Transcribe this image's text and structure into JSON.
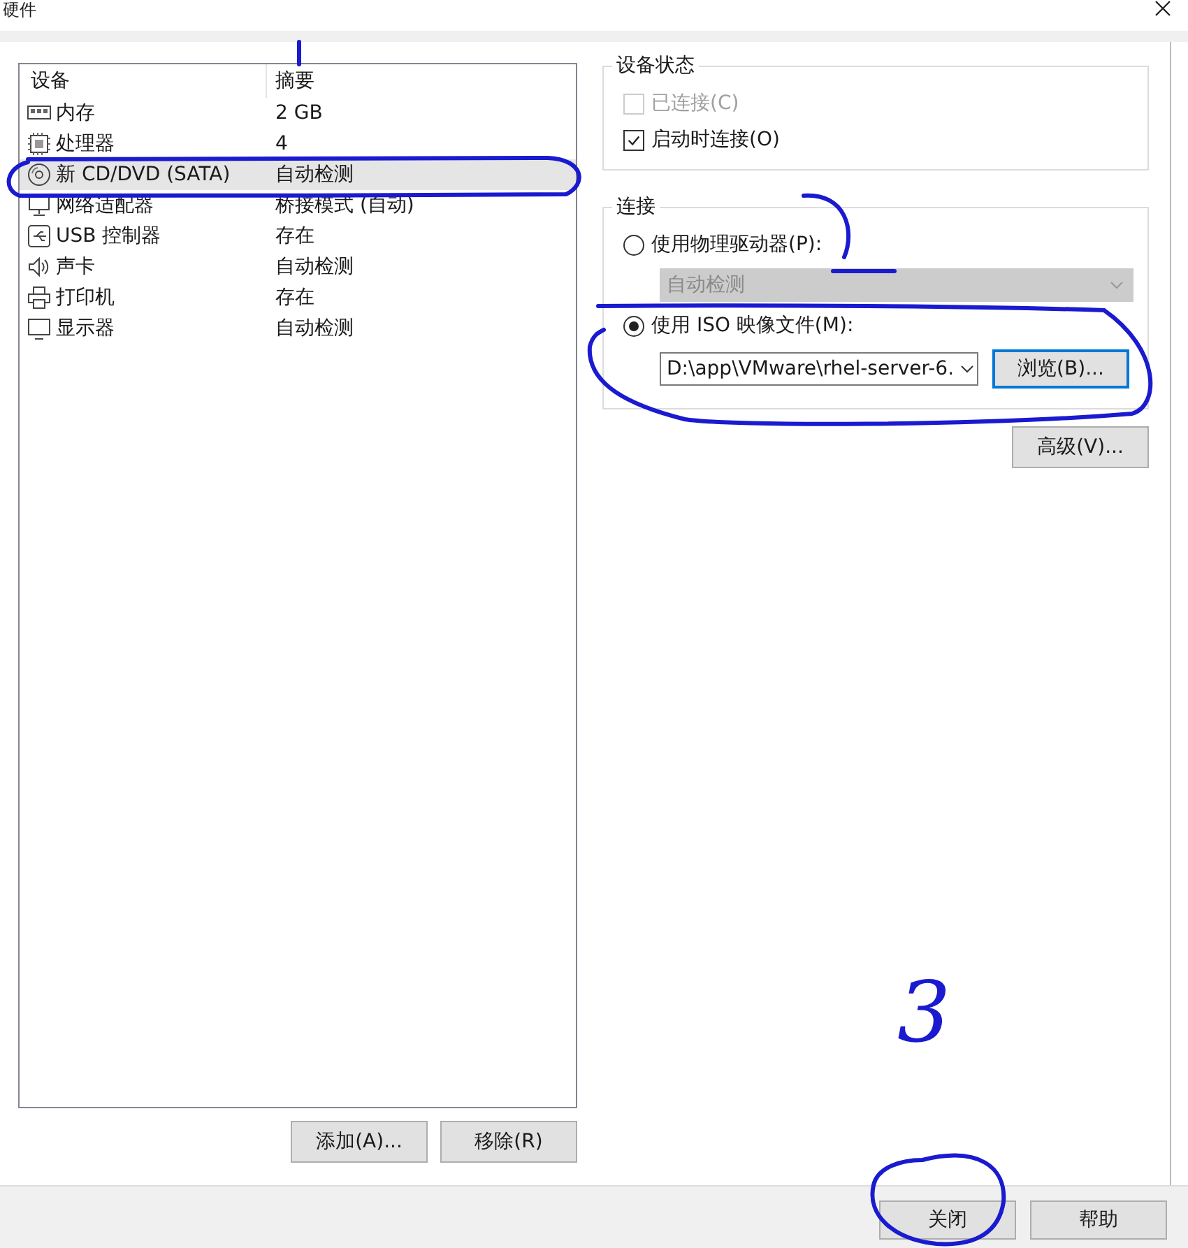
{
  "window": {
    "title": "硬件"
  },
  "device_list": {
    "columns": [
      "设备",
      "摘要"
    ],
    "rows": [
      {
        "kind": "memory",
        "device": "内存",
        "summary": "2 GB",
        "selected": false
      },
      {
        "kind": "cpu",
        "device": "处理器",
        "summary": "4",
        "selected": false
      },
      {
        "kind": "disc",
        "device": "新 CD/DVD (SATA)",
        "summary": "自动检测",
        "selected": true
      },
      {
        "kind": "network",
        "device": "网络适配器",
        "summary": "桥接模式 (自动)",
        "selected": false
      },
      {
        "kind": "usb",
        "device": "USB 控制器",
        "summary": "存在",
        "selected": false
      },
      {
        "kind": "sound",
        "device": "声卡",
        "summary": "自动检测",
        "selected": false
      },
      {
        "kind": "printer",
        "device": "打印机",
        "summary": "存在",
        "selected": false
      },
      {
        "kind": "display",
        "device": "显示器",
        "summary": "自动检测",
        "selected": false
      }
    ]
  },
  "list_buttons": [
    "添加(A)...",
    "移除(R)"
  ],
  "device_status": {
    "title": "设备状态",
    "options": [
      {
        "label": "已连接(C)",
        "checked": false,
        "disabled": true
      },
      {
        "label": "启动时连接(O)",
        "checked": true,
        "disabled": false
      }
    ]
  },
  "connection": {
    "title": "连接",
    "physical": {
      "label": "使用物理驱动器(P):",
      "selected": false,
      "dropdown": {
        "value": "自动检测",
        "disabled": true
      }
    },
    "iso": {
      "label": "使用 ISO 映像文件(M):",
      "selected": true,
      "path": "D:\\app\\VMware\\rhel-server-6.",
      "browse": "浏览(B)..."
    }
  },
  "advanced_button": "高级(V)...",
  "footer_buttons": [
    "关闭",
    "帮助"
  ],
  "annotations": [
    {
      "text": "3"
    }
  ]
}
